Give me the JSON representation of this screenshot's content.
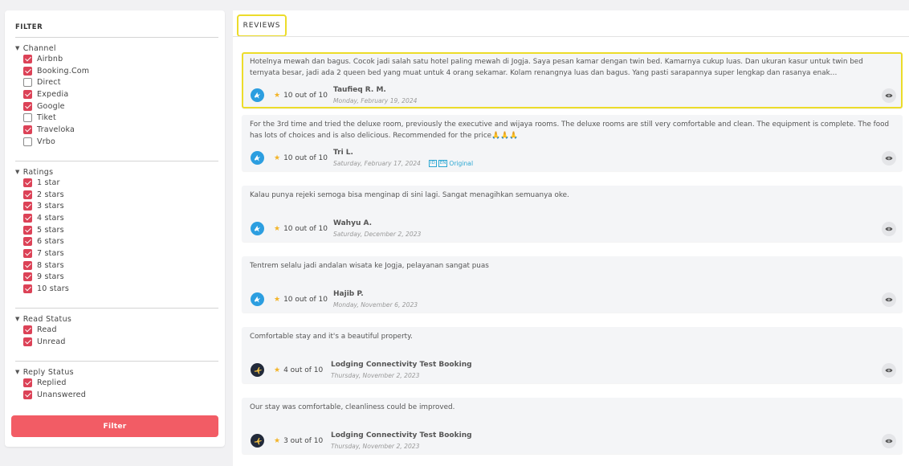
{
  "filter": {
    "title": "FILTER",
    "channel": {
      "label": "Channel",
      "options": [
        {
          "label": "Airbnb",
          "checked": true
        },
        {
          "label": "Booking.Com",
          "checked": true
        },
        {
          "label": "Direct",
          "checked": false
        },
        {
          "label": "Expedia",
          "checked": true
        },
        {
          "label": "Google",
          "checked": true
        },
        {
          "label": "Tiket",
          "checked": false
        },
        {
          "label": "Traveloka",
          "checked": true
        },
        {
          "label": "Vrbo",
          "checked": false
        }
      ]
    },
    "ratings": {
      "label": "Ratings",
      "options": [
        {
          "label": "1 star",
          "checked": true
        },
        {
          "label": "2 stars",
          "checked": true
        },
        {
          "label": "3 stars",
          "checked": true
        },
        {
          "label": "4 stars",
          "checked": true
        },
        {
          "label": "5 stars",
          "checked": true
        },
        {
          "label": "6 stars",
          "checked": true
        },
        {
          "label": "7 stars",
          "checked": true
        },
        {
          "label": "8 stars",
          "checked": true
        },
        {
          "label": "9 stars",
          "checked": true
        },
        {
          "label": "10 stars",
          "checked": true
        }
      ]
    },
    "read_status": {
      "label": "Read Status",
      "options": [
        {
          "label": "Read",
          "checked": true
        },
        {
          "label": "Unread",
          "checked": true
        }
      ]
    },
    "reply_status": {
      "label": "Reply Status",
      "options": [
        {
          "label": "Replied",
          "checked": true
        },
        {
          "label": "Unanswered",
          "checked": true
        }
      ]
    },
    "button_label": "Filter"
  },
  "reviews": {
    "tab_label": "REVIEWS",
    "items": [
      {
        "text": "Hotelnya mewah dan bagus. Cocok jadi salah satu hotel paling mewah di Jogja. Saya pesan kamar dengan twin bed. Kamarnya cukup luas. Dan ukuran kasur untuk twin bed ternyata besar, jadi ada 2 queen bed yang muat untuk 4 orang sekamar. Kolam renangnya luas dan bagus. Yang pasti sarapannya super lengkap dan rasanya enak…",
        "channel_icon": "traveloka-icon",
        "rating": "10 out of 10",
        "author": "Taufieq R. M.",
        "date": "Monday, February 19, 2024",
        "selected": true
      },
      {
        "text": "For the 3rd time and tried the deluxe room, previously the executive and wijaya rooms. The deluxe rooms are still very comfortable and clean. The equipment is complete. The food has lots of choices and is also delicious. Recommended for the price🙏🙏🙏",
        "channel_icon": "traveloka-icon",
        "rating": "10 out of 10",
        "author": "Tri L.",
        "date": "Saturday, February 17, 2024",
        "original_label": "Original",
        "translate_badges": [
          "ID",
          "EN"
        ]
      },
      {
        "text": "Kalau punya rejeki semoga bisa menginap di sini lagi. Sangat menagihkan semuanya oke.",
        "channel_icon": "traveloka-icon",
        "rating": "10 out of 10",
        "author": "Wahyu A.",
        "date": "Saturday, December 2, 2023"
      },
      {
        "text": "Tentrem selalu jadi andalan wisata ke Jogja, pelayanan sangat puas",
        "channel_icon": "traveloka-icon",
        "rating": "10 out of 10",
        "author": "Hajib P.",
        "date": "Monday, November 6, 2023"
      },
      {
        "text": "Comfortable stay and it's a beautiful property.",
        "channel_icon": "expedia-icon",
        "rating": "4 out of 10",
        "author": "Lodging Connectivity Test Booking",
        "date": "Thursday, November 2, 2023"
      },
      {
        "text": "Our stay was comfortable, cleanliness could be improved.",
        "channel_icon": "expedia-icon",
        "rating": "3 out of 10",
        "author": "Lodging Connectivity Test Booking",
        "date": "Thursday, November 2, 2023"
      }
    ]
  },
  "colors": {
    "accent_red": "#f25c65",
    "checkbox_red": "#dc4257",
    "highlight_yellow": "#ecdc2a",
    "traveloka_blue": "#2c9ee0",
    "expedia_dark": "#222a3a",
    "star_gold": "#f3b428"
  }
}
